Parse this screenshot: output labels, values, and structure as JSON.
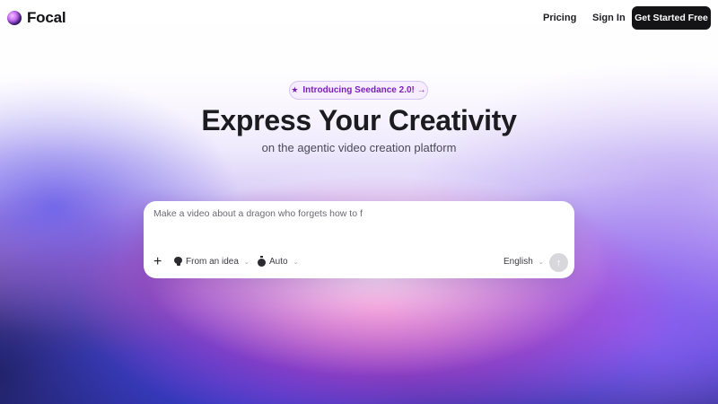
{
  "nav": {
    "brand": "Focal",
    "links": {
      "pricing": "Pricing",
      "sign_in": "Sign In"
    },
    "cta": "Get Started Free"
  },
  "hero": {
    "badge": "Introducing Seedance 2.0! →",
    "badge_icon": "star-icon",
    "title": "Express Your Creativity",
    "subtitle": "on the agentic video creation platform"
  },
  "prompt_box": {
    "placeholder": "Make a video about a dragon who forgets how to f",
    "add_icon": "+",
    "mode_label": "From an idea",
    "duration_label": "Auto",
    "language_label": "English",
    "send_icon": "↑"
  },
  "colors": {
    "accent": "#7a22b8",
    "cta_bg": "#141417",
    "send_disabled": "#d8d8dc"
  }
}
